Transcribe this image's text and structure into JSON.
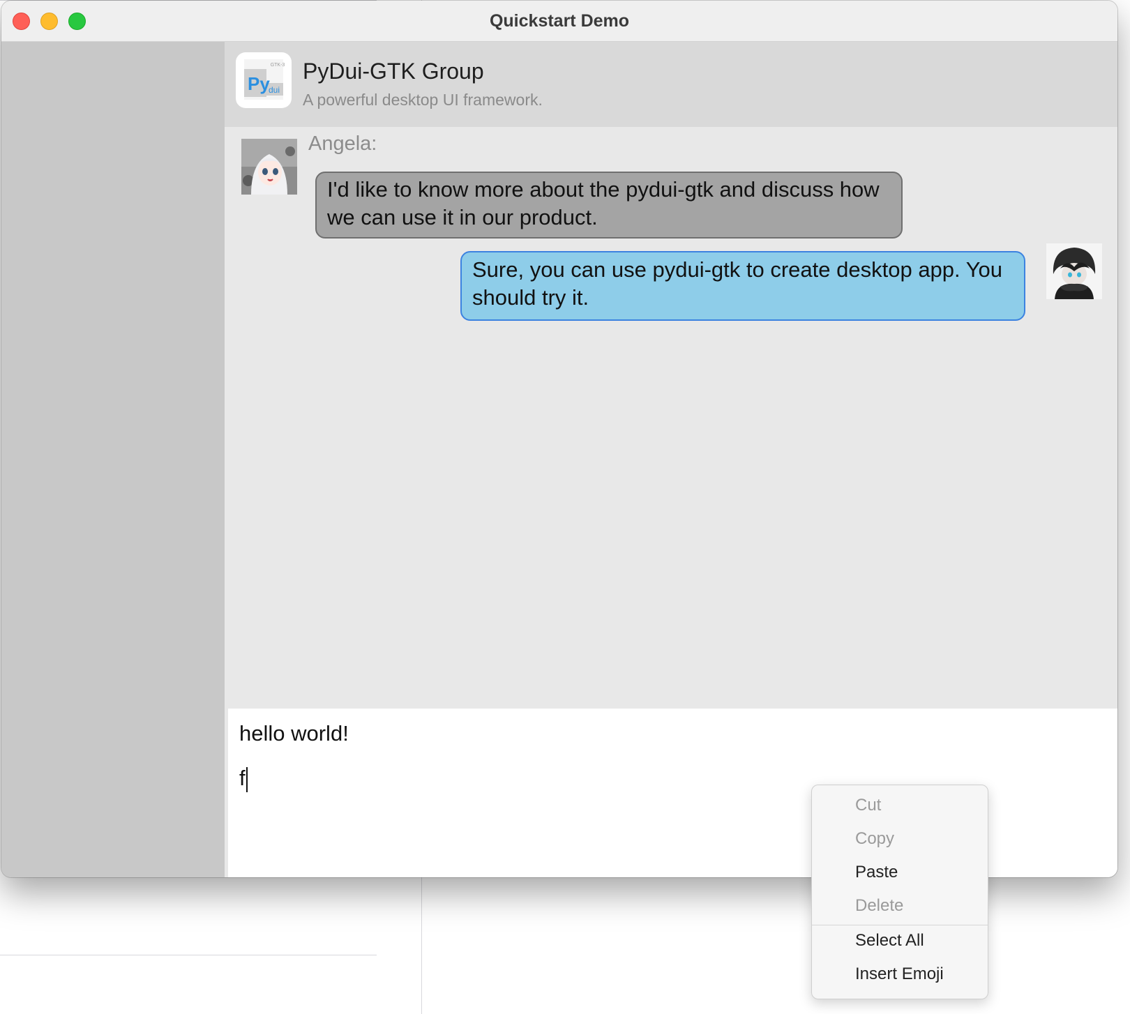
{
  "window": {
    "title": "Quickstart Demo"
  },
  "group": {
    "name": "PyDui-GTK Group",
    "description": "A powerful desktop UI framework.",
    "logo": {
      "main": "Py",
      "sub": "dui",
      "tag": "GTK-3"
    }
  },
  "messages": [
    {
      "sender": "Angela:",
      "text": "I'd like to know more about the pydui-gtk and discuss how we can use it in our product."
    },
    {
      "text": "Sure, you can use pydui-gtk to create desktop app. You should try it."
    }
  ],
  "composer": {
    "line1": "hello world!",
    "line2": "f"
  },
  "context_menu": {
    "items": [
      {
        "label": "Cut",
        "enabled": false
      },
      {
        "label": "Copy",
        "enabled": false
      },
      {
        "label": "Paste",
        "enabled": true
      },
      {
        "label": "Delete",
        "enabled": false
      },
      {
        "label": "Select All",
        "enabled": true
      },
      {
        "label": "Insert Emoji",
        "enabled": true
      }
    ]
  },
  "colors": {
    "incoming_bubble": "#a4a4a4",
    "outgoing_bubble": "#8ecde9",
    "outgoing_border": "#3c82e0",
    "sidebar": "#c8c8c8"
  }
}
